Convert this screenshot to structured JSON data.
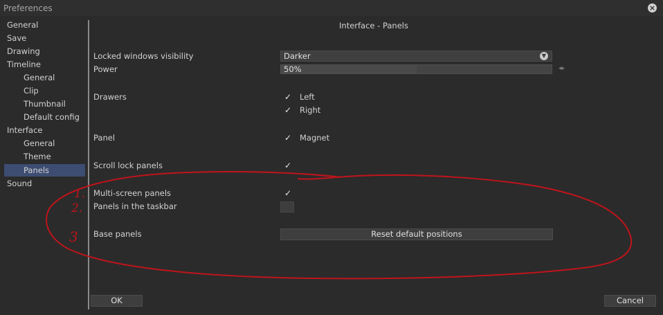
{
  "window": {
    "title": "Preferences"
  },
  "sidebar": {
    "items": [
      {
        "label": "General"
      },
      {
        "label": "Save"
      },
      {
        "label": "Drawing"
      },
      {
        "label": "Timeline"
      },
      {
        "label": "General"
      },
      {
        "label": "Clip"
      },
      {
        "label": "Thumbnail"
      },
      {
        "label": "Default config"
      },
      {
        "label": "Interface"
      },
      {
        "label": "General"
      },
      {
        "label": "Theme"
      },
      {
        "label": "Panels"
      },
      {
        "label": "Sound"
      }
    ],
    "selected": "Panels"
  },
  "panel": {
    "title": "Interface - Panels",
    "locked_windows_visibility": {
      "label": "Locked windows visibility",
      "value": "Darker"
    },
    "power": {
      "label": "Power",
      "value": "50%",
      "fraction": 0.5
    },
    "drawers": {
      "label": "Drawers",
      "left": "Left",
      "right": "Right",
      "left_checked": true,
      "right_checked": true
    },
    "panel_opt": {
      "label": "Panel",
      "magnet": "Magnet",
      "magnet_checked": true
    },
    "scroll_lock": {
      "label": "Scroll lock panels",
      "checked": true
    },
    "multi_screen": {
      "label": "Multi-screen panels",
      "checked": true
    },
    "taskbar": {
      "label": "Panels in the taskbar",
      "checked": false
    },
    "base_panels": {
      "label": "Base panels",
      "button": "Reset default positions"
    }
  },
  "footer": {
    "ok": "OK",
    "cancel": "Cancel"
  },
  "annotations": {
    "marks": [
      "1.",
      "2.",
      "3"
    ],
    "color": "#c0141b"
  },
  "colors": {
    "background": "#2b2b2b",
    "selection": "#3d4d72"
  },
  "icons": {
    "close": "close-icon",
    "dropdown": "chevron-down-icon",
    "check": "checkmark-icon"
  }
}
